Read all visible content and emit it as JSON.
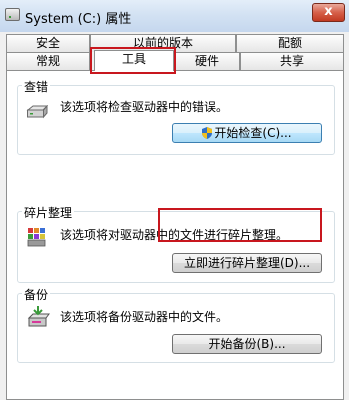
{
  "window": {
    "title": "System (C:) 属性",
    "close_label": "x"
  },
  "tabs": {
    "row1": [
      "安全",
      "以前的版本",
      "配额"
    ],
    "row2": [
      "常规",
      "工具",
      "硬件",
      "共享"
    ],
    "selected": "工具"
  },
  "groups": {
    "check": {
      "title": "查错",
      "desc": "该选项将检查驱动器中的错误。",
      "button_label": "开始检查(C)..."
    },
    "defrag": {
      "title": "碎片整理",
      "desc": "该选项将对驱动器中的文件进行碎片整理。",
      "button_label": "立即进行碎片整理(D)..."
    },
    "backup": {
      "title": "备份",
      "desc": "该选项将备份驱动器中的文件。",
      "button_label": "开始备份(B)..."
    }
  },
  "colors": {
    "highlight": "#c8171e",
    "accent": "#3c7fb1"
  },
  "icons": {
    "drive": "hard-drive-icon",
    "defrag": "defrag-icon",
    "backup": "backup-icon",
    "shield": "uac-shield-icon"
  }
}
